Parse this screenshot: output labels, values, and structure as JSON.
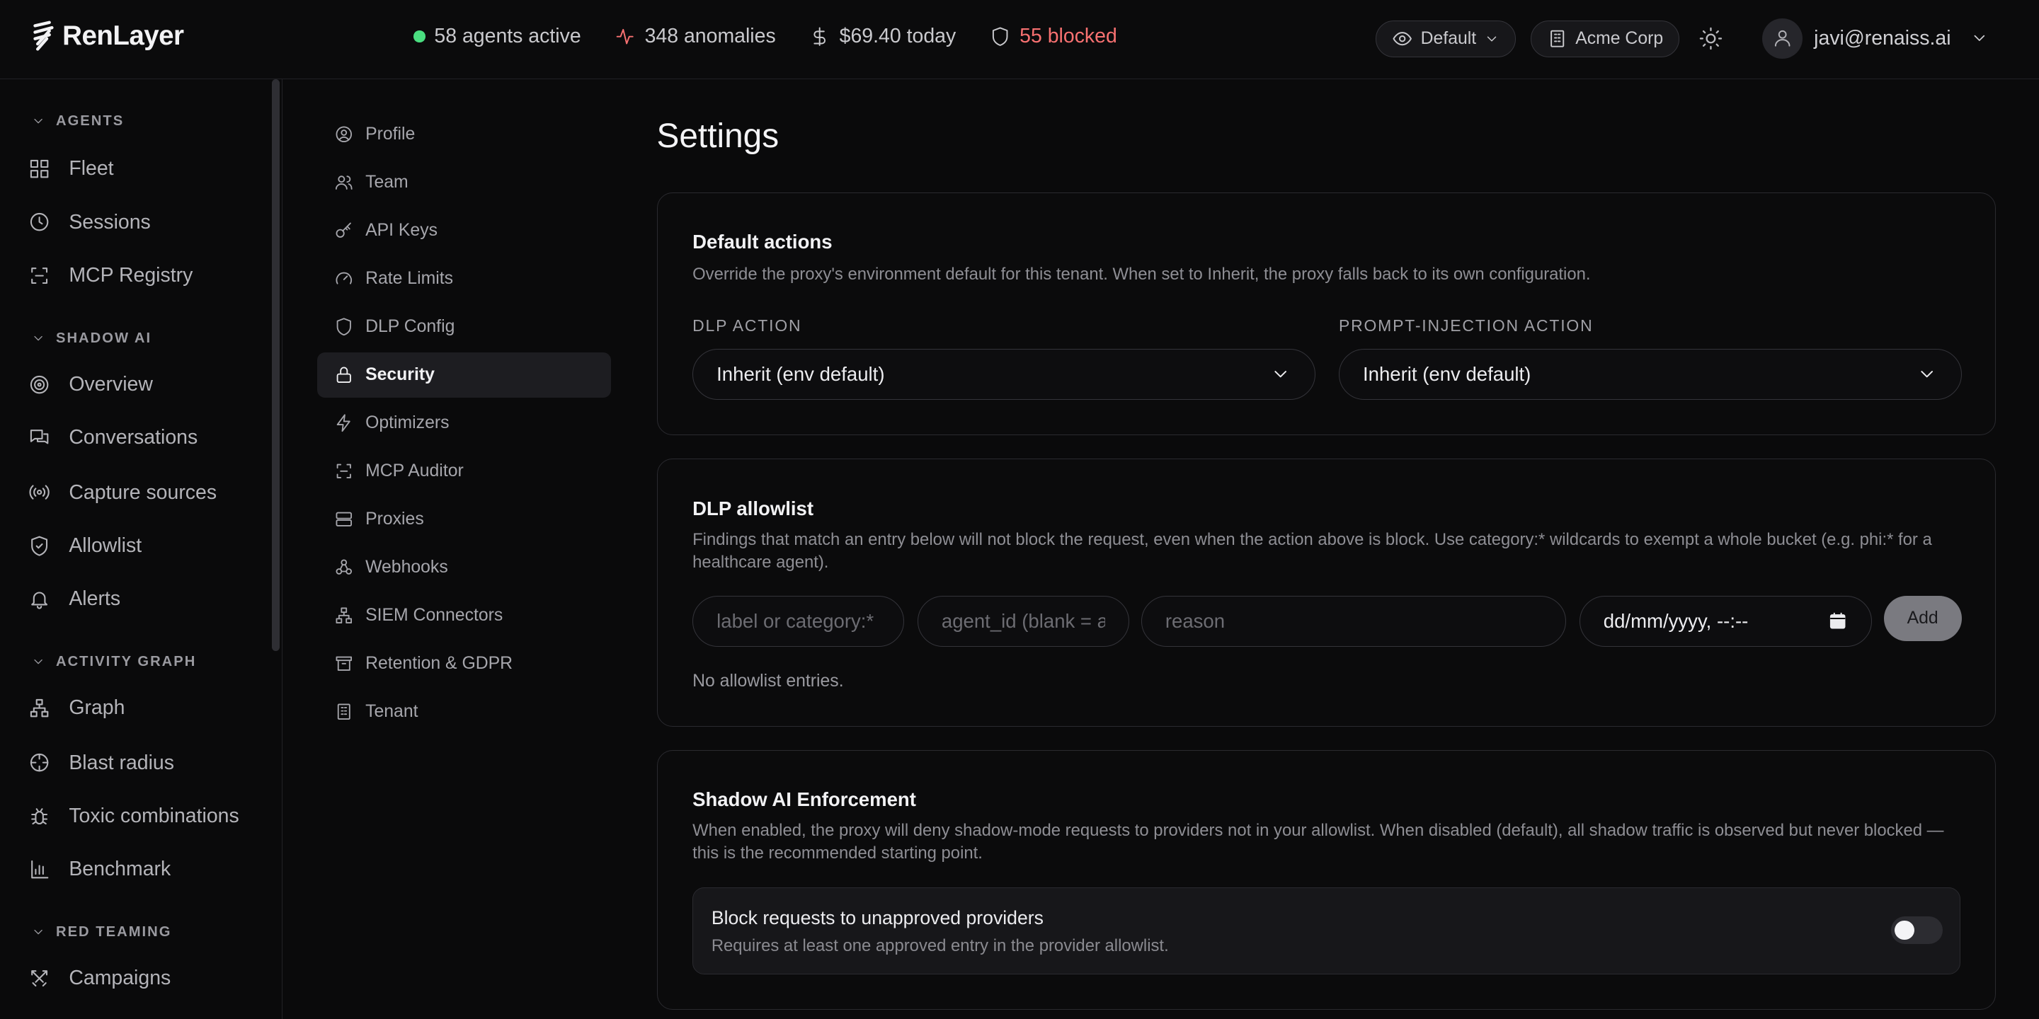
{
  "app": {
    "name": "RenLayer"
  },
  "topbar": {
    "agents_active": "58 agents active",
    "anomalies": "348 anomalies",
    "spend": "$69.40 today",
    "blocked": "55 blocked",
    "view": "Default",
    "org": "Acme Corp",
    "user_email": "javi@renaiss.ai"
  },
  "sidebar": {
    "sections": [
      {
        "title": "AGENTS",
        "items": [
          "Fleet",
          "Sessions",
          "MCP Registry"
        ]
      },
      {
        "title": "SHADOW AI",
        "items": [
          "Overview",
          "Conversations",
          "Capture sources",
          "Allowlist",
          "Alerts"
        ]
      },
      {
        "title": "ACTIVITY GRAPH",
        "items": [
          "Graph",
          "Blast radius",
          "Toxic combinations",
          "Benchmark"
        ]
      },
      {
        "title": "RED TEAMING",
        "items": [
          "Campaigns"
        ]
      }
    ]
  },
  "settings_nav": [
    "Profile",
    "Team",
    "API Keys",
    "Rate Limits",
    "DLP Config",
    "Security",
    "Optimizers",
    "MCP Auditor",
    "Proxies",
    "Webhooks",
    "SIEM Connectors",
    "Retention & GDPR",
    "Tenant"
  ],
  "settings_nav_active": "Security",
  "page": {
    "title": "Settings",
    "default_actions": {
      "title": "Default actions",
      "description": "Override the proxy's environment default for this tenant. When set to Inherit, the proxy falls back to its own configuration.",
      "dlp_label": "DLP ACTION",
      "dlp_value": "Inherit (env default)",
      "pi_label": "PROMPT-INJECTION ACTION",
      "pi_value": "Inherit (env default)"
    },
    "dlp_allowlist": {
      "title": "DLP allowlist",
      "description": "Findings that match an entry below will not block the request, even when the action above is block. Use category:* wildcards to exempt a whole bucket (e.g. phi:* for a healthcare agent).",
      "label_placeholder": "label or category:*",
      "agent_placeholder": "agent_id (blank = all)",
      "reason_placeholder": "reason",
      "date_value": "dd/mm/yyyy, --:--",
      "add_label": "Add",
      "empty_text": "No allowlist entries."
    },
    "shadow_enforcement": {
      "title": "Shadow AI Enforcement",
      "description": "When enabled, the proxy will deny shadow-mode requests to providers not in your allowlist. When disabled (default), all shadow traffic is observed but never blocked — this is the recommended starting point.",
      "toggle_title": "Block requests to unapproved providers",
      "toggle_sub": "Requires at least one approved entry in the provider allowlist.",
      "enabled": false
    }
  },
  "colors": {
    "accent_green": "#4ade80",
    "danger": "#f87171",
    "background": "#0a0a0b"
  }
}
